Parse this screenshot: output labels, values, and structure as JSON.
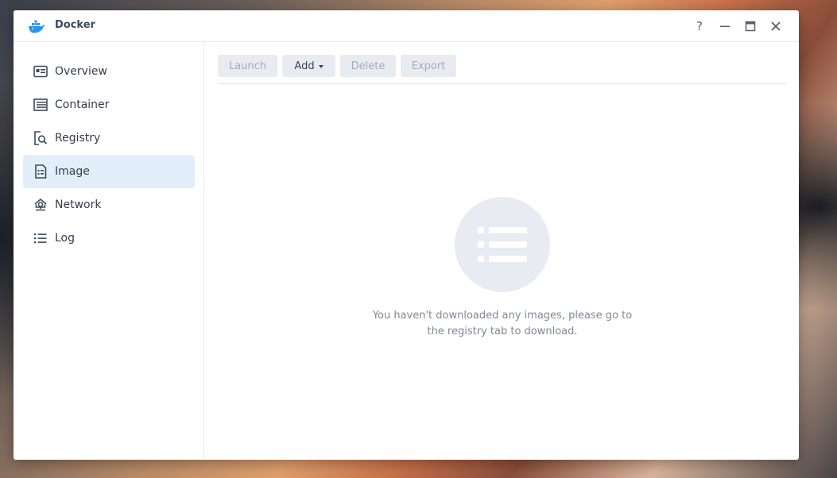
{
  "window": {
    "title": "Docker",
    "controls": [
      "?",
      "minimize",
      "maximize",
      "close"
    ]
  },
  "sidebar": {
    "items": [
      {
        "label": "Overview",
        "icon": "overview-icon",
        "active": false
      },
      {
        "label": "Container",
        "icon": "container-icon",
        "active": false
      },
      {
        "label": "Registry",
        "icon": "registry-icon",
        "active": false
      },
      {
        "label": "Image",
        "icon": "image-icon",
        "active": true
      },
      {
        "label": "Network",
        "icon": "network-icon",
        "active": false
      },
      {
        "label": "Log",
        "icon": "log-icon",
        "active": false
      }
    ]
  },
  "toolbar": {
    "launch_label": "Launch",
    "add_label": "Add",
    "delete_label": "Delete",
    "export_label": "Export"
  },
  "empty_state": {
    "icon": "list-icon",
    "message_line1": "You haven't downloaded any images, please go to",
    "message_line2": "the registry tab to download."
  },
  "colors": {
    "accent_active_bg": "#e3eefb",
    "docker_blue": "#2496ed",
    "button_bg": "#e8ecf1",
    "disabled_text": "#a4adb9",
    "empty_icon_bg": "#e8ecf2"
  }
}
